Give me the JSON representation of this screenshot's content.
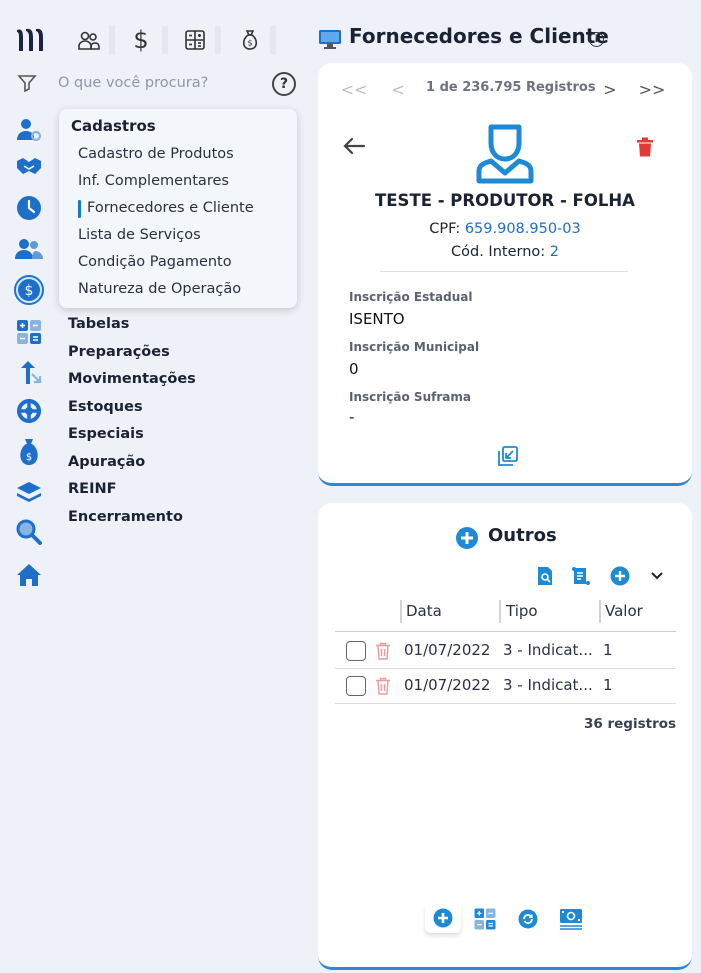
{
  "search": {
    "placeholder": "O que você procura?"
  },
  "flyout": {
    "title": "Cadastros",
    "items": [
      {
        "label": "Cadastro de Produtos"
      },
      {
        "label": "Inf. Complementares"
      },
      {
        "label": "Fornecedores e Cliente",
        "selected": true
      },
      {
        "label": "Lista de Serviços"
      },
      {
        "label": "Condição Pagamento"
      },
      {
        "label": "Natureza de Operação"
      }
    ]
  },
  "menu": [
    "Tabelas",
    "Preparações",
    "Movimentações",
    "Estoques",
    "Especiais",
    "Apuração",
    "REINF",
    "Encerramento"
  ],
  "header": {
    "title": "Fornecedores e Cliente"
  },
  "record": {
    "pager_text": "1 de 236.795 Registros",
    "name": "TESTE - PRODUTOR - FOLHA",
    "cpf_label": "CPF:",
    "cpf_value": "659.908.950-03",
    "cod_label": "Cód. Interno:",
    "cod_value": "2",
    "fields": [
      {
        "label": "Inscrição Estadual",
        "value": "ISENTO"
      },
      {
        "label": "Inscrição Municipal",
        "value": "0"
      },
      {
        "label": "Inscrição Suframa",
        "value": "-"
      }
    ]
  },
  "outros": {
    "title": "Outros",
    "columns": [
      "Data",
      "Tipo",
      "Valor"
    ],
    "rows": [
      {
        "data": "01/07/2022",
        "tipo": "3 - Indicat...",
        "valor": "1"
      },
      {
        "data": "01/07/2022",
        "tipo": "3 - Indicat...",
        "valor": "1"
      }
    ],
    "count_label": "36 registros"
  },
  "colors": {
    "accent": "#1976d2",
    "danger": "#e53935",
    "background": "#eef2f8"
  }
}
